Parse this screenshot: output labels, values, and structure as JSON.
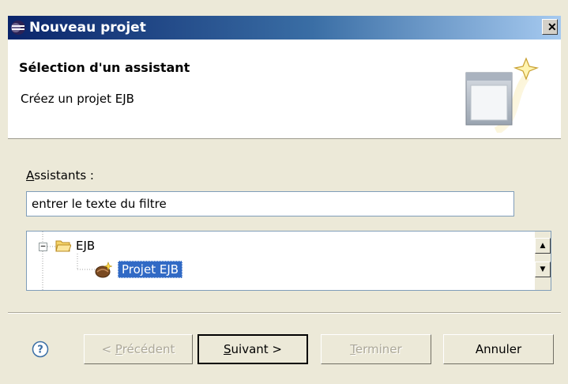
{
  "window": {
    "title": "Nouveau projet",
    "close_label": "✕"
  },
  "banner": {
    "heading": "Sélection d'un assistant",
    "description": "Créez un projet EJB"
  },
  "wizards": {
    "label_mnemonic": "A",
    "label_rest": "ssistants :",
    "filter_value": "entrer le texte du filtre",
    "tree": [
      {
        "label": "EJB",
        "expanded": true,
        "children": [
          {
            "label": "Projet EJB",
            "selected": true
          }
        ]
      }
    ],
    "expander": "−"
  },
  "footer": {
    "prev": {
      "mnemonic": "P",
      "pre": "< ",
      "rest": "récédent",
      "enabled": false
    },
    "next": {
      "mnemonic": "S",
      "pre": "",
      "rest": "uivant >",
      "enabled": true,
      "default": true
    },
    "finish": {
      "mnemonic": "T",
      "pre": "",
      "rest": "erminer",
      "enabled": false
    },
    "cancel": {
      "label": "Annuler",
      "enabled": true
    }
  },
  "icons": {
    "app": "eclipse-icon",
    "help": "help-icon",
    "folder": "folder-open-icon",
    "project": "ejb-project-icon",
    "wizard": "new-wizard-icon"
  },
  "colors": {
    "title_start": "#0a246a",
    "title_end": "#a6caf0",
    "selection": "#316ac5",
    "face": "#ece9d8"
  }
}
